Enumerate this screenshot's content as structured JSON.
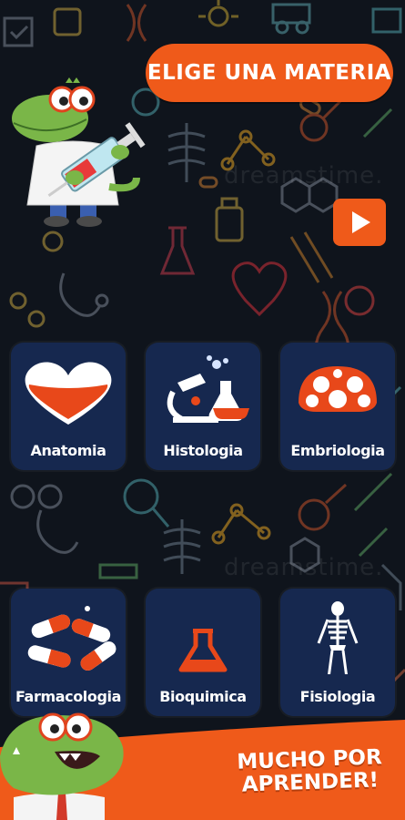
{
  "header": {
    "title": "ELIGE UNA MATERIA"
  },
  "watermark": "dreamstime.",
  "subjects": [
    {
      "label": "Anatomia",
      "icon": "heart-icon"
    },
    {
      "label": "Histologia",
      "icon": "microscope-flask-icon"
    },
    {
      "label": "Embriologia",
      "icon": "embryo-icon"
    },
    {
      "label": "Farmacologia",
      "icon": "pills-icon"
    },
    {
      "label": "Bioquimica",
      "icon": "flask-icon"
    },
    {
      "label": "Fisiologia",
      "icon": "skeleton-icon"
    }
  ],
  "footer": {
    "slogan_line1": "MUCHO POR",
    "slogan_line2": "APRENDER!"
  },
  "colors": {
    "accent": "#ef5a1a",
    "tile": "#16284f",
    "background": "#0f141c"
  }
}
